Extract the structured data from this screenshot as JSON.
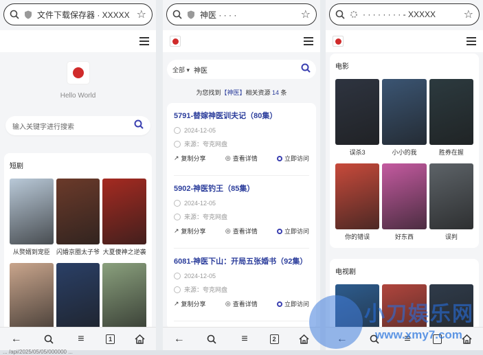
{
  "panel1": {
    "url": "文件下载保存器 · XXXXX",
    "hero_text": "Hello World",
    "search_placeholder": "输入关键字进行搜索",
    "section_title": "短剧",
    "items": [
      {
        "title": "从赘婿到宠臣",
        "color": "#b9c9d8"
      },
      {
        "title": "闪婚京圈太子爷",
        "color": "#6b3a2a"
      },
      {
        "title": "大夏傻神之逆袭",
        "color": "#a52a21"
      },
      {
        "title": "",
        "color": "#c9a58c"
      },
      {
        "title": "",
        "color": "#2a3f66"
      },
      {
        "title": "",
        "color": "#8aa07d"
      }
    ],
    "tab_count": "1"
  },
  "panel2": {
    "url": "神医 · · · ·",
    "category": "全部",
    "query": "神医",
    "found_prefix": "为您找到",
    "found_keyword": "【神医】",
    "found_mid": "相关资源",
    "found_count": "14",
    "found_suffix": "条",
    "results": [
      {
        "title": "5791-替嫁神医训夫记（80集）",
        "date": "2024-12-05",
        "source": "来源：夸克网盘"
      },
      {
        "title": "5902-神医钓王（85集）",
        "date": "2024-12-05",
        "source": "来源：夸克网盘"
      },
      {
        "title": "6081-神医下山：开局五张婚书（92集）",
        "date": "2024-12-05",
        "source": "来源：夸克网盘"
      }
    ],
    "action_share": "复制分享",
    "action_detail": "查看详情",
    "action_visit": "立即访问",
    "tab_count": "2"
  },
  "panel3": {
    "url": "· · · · · · · · - XXXXX",
    "movie_title": "电影",
    "movies": [
      {
        "title": "误杀3",
        "color": "#2e3440"
      },
      {
        "title": "小小的我",
        "color": "#3b5573"
      },
      {
        "title": "胜券在握",
        "color": "#2c3a3f"
      },
      {
        "title": "你的错误",
        "color": "#c84a3b"
      },
      {
        "title": "好东西",
        "color": "#c45aa0"
      },
      {
        "title": "误判",
        "color": "#5d6368"
      }
    ],
    "tv_title": "电视剧",
    "tv": [
      {
        "color": "#2d5c8e"
      },
      {
        "color": "#b0453d"
      },
      {
        "color": "#2f3b4a"
      }
    ]
  },
  "watermark": {
    "title": "小刀娱乐网",
    "url": "www.xmy7.com"
  },
  "footer_url": "... /api/2025/05/05/000000 ..."
}
